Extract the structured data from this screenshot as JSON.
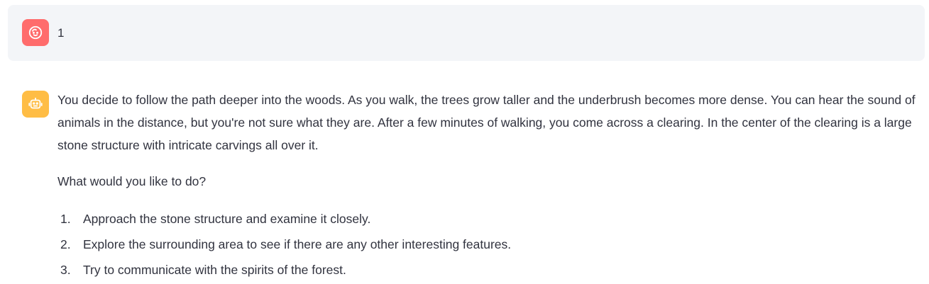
{
  "messages": {
    "user": {
      "avatar_icon": "user-face-icon",
      "avatar_color": "#ff6c6c",
      "text": "1"
    },
    "assistant": {
      "avatar_icon": "robot-icon",
      "avatar_color": "#ffbd45",
      "paragraphs": [
        "You decide to follow the path deeper into the woods. As you walk, the trees grow taller and the underbrush becomes more dense. You can hear the sound of animals in the distance, but you're not sure what they are. After a few minutes of walking, you come across a clearing. In the center of the clearing is a large stone structure with intricate carvings all over it.",
        "What would you like to do?"
      ],
      "options": [
        {
          "number": "1.",
          "text": "Approach the stone structure and examine it closely."
        },
        {
          "number": "2.",
          "text": "Explore the surrounding area to see if there are any other interesting features."
        },
        {
          "number": "3.",
          "text": "Try to communicate with the spirits of the forest."
        }
      ]
    }
  }
}
